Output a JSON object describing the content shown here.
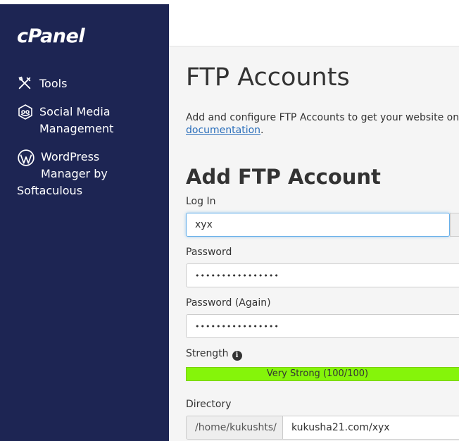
{
  "sidebar": {
    "logo": "cPanel",
    "items": [
      {
        "label": "Tools",
        "icon": "tools-icon"
      },
      {
        "label_line1": "Social Media",
        "label_line2": "Management",
        "icon": "social-media-icon"
      },
      {
        "label_line1": "WordPress",
        "label_line2": "Manager by",
        "label_line3": "Softaculous",
        "icon": "wordpress-icon"
      }
    ],
    "bg_color": "#1d2553"
  },
  "main": {
    "title": "FTP Accounts",
    "description": "Add and configure FTP Accounts to get your website on the",
    "doc_link": "documentation",
    "doc_suffix": ".",
    "section_title": "Add FTP Account",
    "form": {
      "login_label": "Log In",
      "login_value": "xyx",
      "password_label": "Password",
      "password_value": "••••••••••••••••",
      "password_again_label": "Password (Again)",
      "password_again_value": "••••••••••••••••",
      "strength_label": "Strength",
      "strength_text": "Very Strong (100/100)",
      "strength_color": "#85f50a",
      "directory_label": "Directory",
      "directory_prefix": "/home/kukushts/",
      "directory_value": "kukusha21.com/xyx"
    },
    "link_color": "#2a6ebb"
  }
}
